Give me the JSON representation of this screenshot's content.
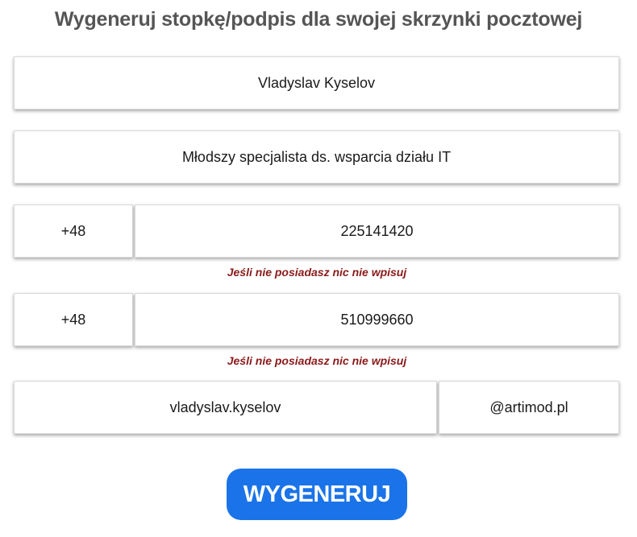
{
  "page_title": "Wygeneruj stopkę/podpis dla swojej skrzynki pocztowej",
  "form": {
    "name_value": "Vladyslav Kyselov",
    "position_value": "Młodszy specjalista ds. wsparcia działu IT",
    "phone1": {
      "prefix": "+48",
      "number": "225141420",
      "hint": "Jeśli nie posiadasz nic nie wpisuj"
    },
    "phone2": {
      "prefix": "+48",
      "number": "510999660",
      "hint": "Jeśli nie posiadasz nic nie wpisuj"
    },
    "email": {
      "local_part": "vladyslav.kyselov",
      "domain": "@artimod.pl"
    }
  },
  "submit_label": "WYGENERUJ",
  "colors": {
    "button": "#1a73e8",
    "hint": "#8b1a1a",
    "title": "#555555"
  }
}
